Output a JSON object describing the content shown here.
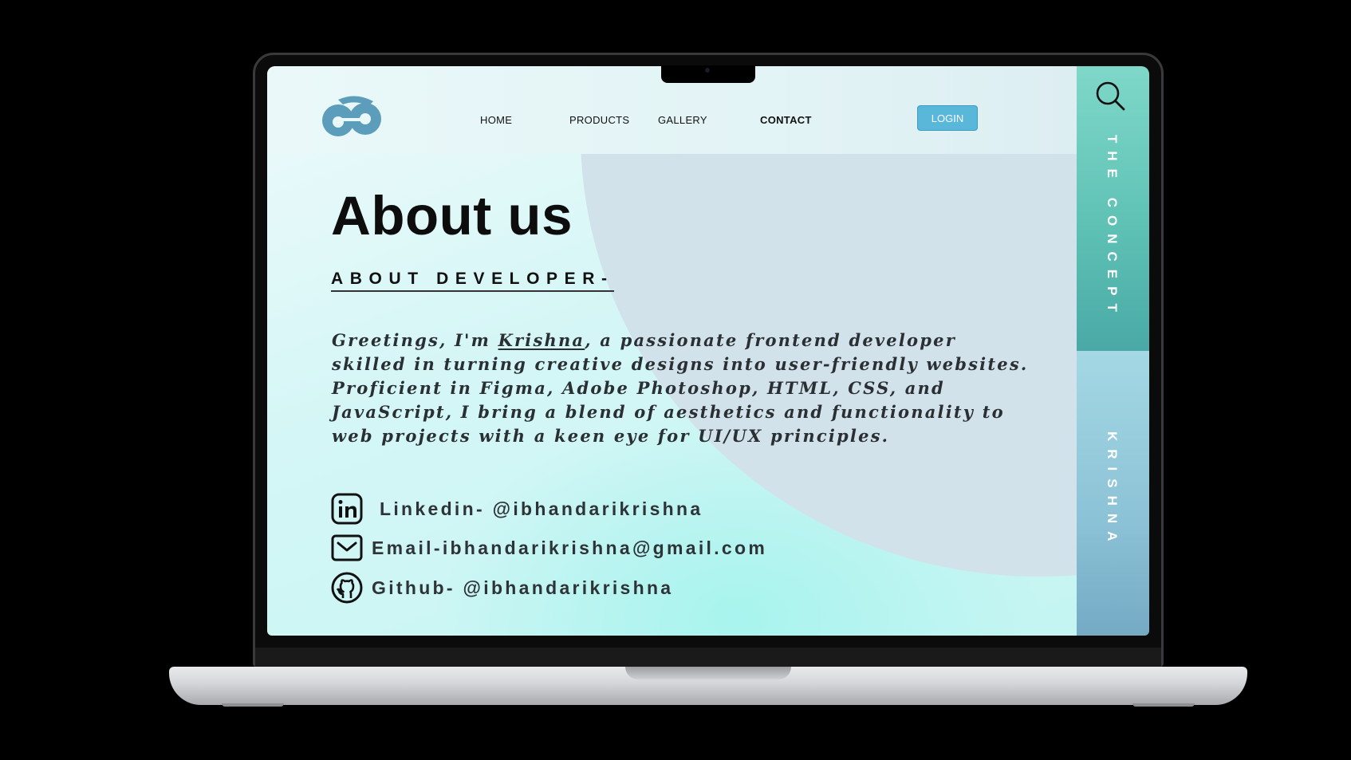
{
  "nav": {
    "home": "HOME",
    "products": "PRODUCTS",
    "gallery": "GALLERY",
    "contact": "CONTACT",
    "login": "LOGIN"
  },
  "hero": {
    "title": "About us",
    "subtitle": "ABOUT DEVELOPER-"
  },
  "bio": {
    "before": "Greetings, I'm ",
    "name_link": "Krishna",
    "after": ", a passionate frontend developer skilled in turning creative designs into user-friendly websites. Proficient in Figma, Adobe Photoshop, HTML, CSS, and JavaScript, I bring a blend of aesthetics and functionality to web projects with a keen eye for UI/UX principles."
  },
  "contacts": {
    "linkedin": "Linkedin- @ibhandarikrishna",
    "email": "Email-ibhandarikrishna@gmail.com",
    "github": "Github- @ibhandarikrishna"
  },
  "side": {
    "top_label": "THE CONCEPT",
    "bottom_label": "KRISHNA"
  },
  "icons": {
    "logo": "logo-icon",
    "search": "search-icon",
    "linkedin": "linkedin-icon",
    "email": "mail-icon",
    "github": "github-icon"
  },
  "colors": {
    "accent": "#59b8d9",
    "side_top": "#5fc2b5",
    "side_bottom": "#8cc2d6",
    "logo": "#5b9dba"
  }
}
